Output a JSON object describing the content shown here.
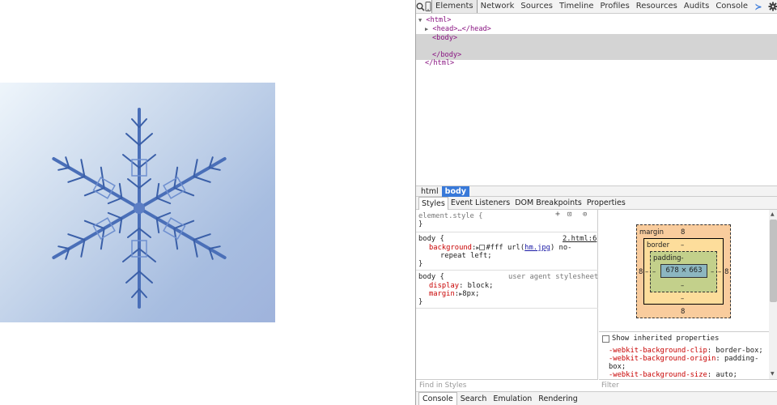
{
  "toolbar": {
    "tabs": [
      "Elements",
      "Network",
      "Sources",
      "Timeline",
      "Profiles",
      "Resources",
      "Audits",
      "Console"
    ],
    "active_tab": "Elements"
  },
  "dom_tree": {
    "lines": [
      "<html>",
      "<head>…</head>",
      "<body>",
      "</body>",
      "</html>"
    ]
  },
  "breadcrumb": [
    "html",
    "body"
  ],
  "subtabs": [
    "Styles",
    "Event Listeners",
    "DOM Breakpoints",
    "Properties"
  ],
  "styles": {
    "element_style": "element.style {",
    "close_brace": "}",
    "rule1": {
      "selector": "body {",
      "source": "2.html:6",
      "prop": "background",
      "value_pre": "#fff url(",
      "value_link": "hm.jpg",
      "value_post": ") no-",
      "value_wrap": "repeat left;"
    },
    "rule2": {
      "selector": "body {",
      "source": "user agent stylesheet",
      "prop1": "display",
      "val1": "block;",
      "prop2": "margin",
      "val2": "8px;"
    },
    "find_placeholder": "Find in Styles"
  },
  "metrics": {
    "margin_label": "margin",
    "margin_top": "8",
    "margin_bottom": "8",
    "margin_left": "8",
    "margin_right": "8",
    "border_label": "border",
    "border_val": "–",
    "padding_label": "padding-",
    "padding_val": "–",
    "content": "678 × 663"
  },
  "inherited": {
    "label": "Show inherited properties",
    "p1": "-webkit-background-clip",
    "v1": "border-box;",
    "p2": "-webkit-background-origin",
    "v2": "padding-",
    "v2b": "box;",
    "p3": "-webkit-background-size",
    "v3": "auto;"
  },
  "filter_placeholder": "Filter",
  "drawer_tabs": [
    "Console",
    "Search",
    "Emulation",
    "Rendering"
  ],
  "colors": {
    "accent": "#3879d9",
    "tag": "#881280",
    "css_prop": "#c80000"
  }
}
